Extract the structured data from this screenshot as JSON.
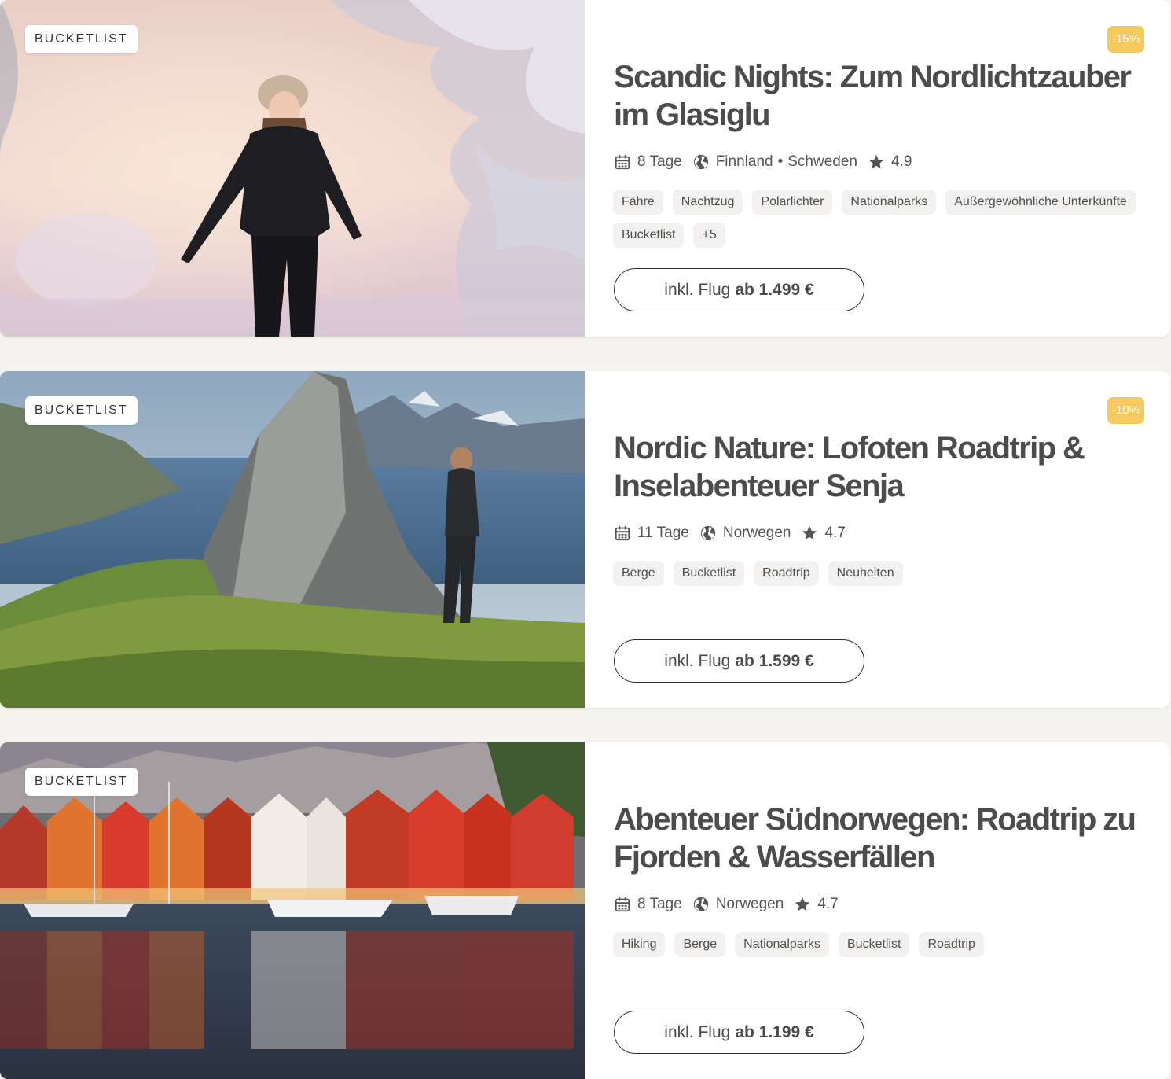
{
  "colors": {
    "background": "#f6f4f0",
    "card": "#ffffff",
    "discount": "#f4c95d",
    "tag": "#f2f1ef",
    "text": "#4a4a4a"
  },
  "trips": [
    {
      "badge": "BUCKETLIST",
      "discount": "-15%",
      "title": "Scandic Nights: Zum Nordlichtzauber im Glasiglu",
      "duration": "8 Tage",
      "countries": [
        "Finnland",
        "Schweden"
      ],
      "rating": "4.9",
      "tags": [
        "Fähre",
        "Nachtzug",
        "Polarlichter",
        "Nationalparks",
        "Außergewöhnliche Unterkünfte",
        "Bucketlist",
        "+5"
      ],
      "price_prefix": "inkl. Flug",
      "price_value": "ab 1.499 €",
      "image": "winter-forest-woman-photo"
    },
    {
      "badge": "BUCKETLIST",
      "discount": "-10%",
      "title": "Nordic Nature: Lofoten Roadtrip & Inselabenteuer Senja",
      "duration": "11 Tage",
      "countries": [
        "Norwegen"
      ],
      "rating": "4.7",
      "tags": [
        "Berge",
        "Bucketlist",
        "Roadtrip",
        "Neuheiten"
      ],
      "price_prefix": "inkl. Flug",
      "price_value": "ab 1.599 €",
      "image": "mountain-fjord-hiker-photo"
    },
    {
      "badge": "BUCKETLIST",
      "title": "Abenteuer Südnorwegen: Roadtrip zu Fjorden & Wasserfällen",
      "duration": "8 Tage",
      "countries": [
        "Norwegen"
      ],
      "rating": "4.7",
      "tags": [
        "Hiking",
        "Berge",
        "Nationalparks",
        "Bucketlist",
        "Roadtrip"
      ],
      "price_prefix": "inkl. Flug",
      "price_value": "ab 1.199 €",
      "image": "bergen-harbour-houses-photo"
    }
  ]
}
